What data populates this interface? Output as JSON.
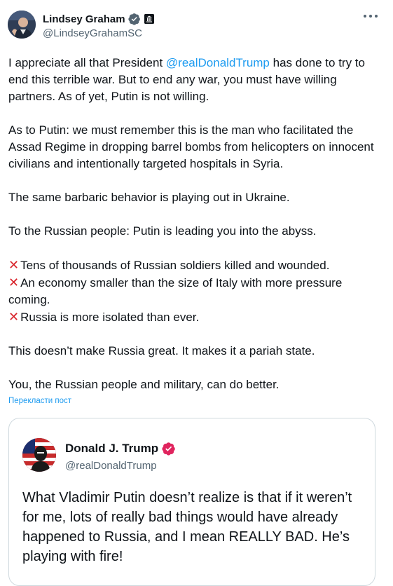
{
  "author": {
    "name": "Lindsey Graham",
    "handle": "@LindseyGrahamSC"
  },
  "tweet": {
    "p1_pre": "I appreciate all that President ",
    "p1_mention": "@realDonaldTrump",
    "p1_post": " has done to try to end this terrible war. But to end any war, you must have willing partners. As of yet, Putin is not willing.",
    "p2": "As to Putin: we must remember this is the man who facilitated the Assad Regime in dropping barrel bombs from helicopters on innocent civilians and intentionally targeted hospitals in Syria.",
    "p3": "The same barbaric behavior is playing out in Ukraine.",
    "p4": "To the Russian people: Putin is leading you into the abyss.",
    "bullets": [
      "Tens of thousands of Russian soldiers killed and wounded.",
      "An economy smaller than the size of Italy with more pressure coming.",
      "Russia is more isolated than ever."
    ],
    "p5": "This doesn’t make Russia great. It makes it a pariah state.",
    "p6": "You, the Russian people and military, can do better."
  },
  "translate_link": "Перекласти пост",
  "quote": {
    "name": "Donald J. Trump",
    "handle": "@realDonaldTrump",
    "text": "What Vladimir Putin doesn’t realize is that if it weren’t for me, lots of really bad things would have already happened to Russia, and I mean REALLY BAD. He’s playing with fire!"
  },
  "colors": {
    "link": "#1d9bf0",
    "verified_blue": "#1d9bf0",
    "verified_pink": "#e0245e",
    "cross_mark": "#d8232a"
  },
  "icons": {
    "verified": "verified-badge-icon",
    "gov": "government-badge-icon",
    "more": "more-options-icon",
    "cross": "cross-mark-icon"
  }
}
